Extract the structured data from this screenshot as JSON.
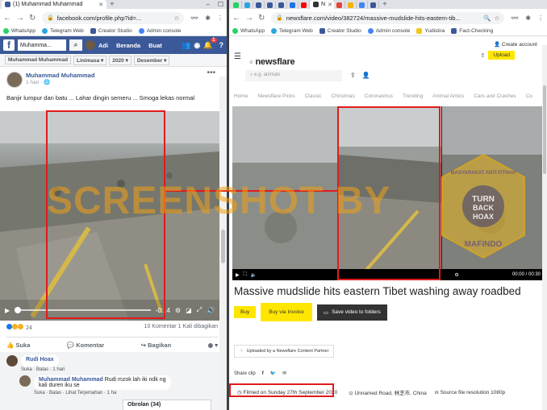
{
  "left_browser": {
    "tab_title": "(1) Muhammad Muhammad",
    "url": "facebook.com/profile.php?id=...",
    "bookmarks": [
      "WhatsApp",
      "Telegram Web",
      "Creator Studio",
      "Admin console"
    ]
  },
  "facebook": {
    "search_value": "Muhamma...",
    "nav": [
      "Adi",
      "Beranda",
      "Buat"
    ],
    "notif_count": "1",
    "subbar": [
      "Muhammad Muhammad",
      "Linimasa ▾",
      "2020 ▾",
      "Desember ▾"
    ],
    "post": {
      "author": "Muhammad Muhammad",
      "time": "1 hari · 🌐",
      "text": "Banjir lumpur dan batu ... Lahar dingin semeru ... Smoga lekas normal"
    },
    "video": {
      "time": "-0:14"
    },
    "reactions_count": "24",
    "stats": "10 Komentar  1 Kali dibagikan",
    "actions": [
      "Suka",
      "Komentar",
      "Bagikan"
    ],
    "comments": [
      {
        "author": "Rudi Hoax",
        "text": "",
        "meta": "Suka · Balas · 1 hari"
      },
      {
        "author": "Muhammad Muhammad",
        "text": "Rudi mzok lah iki ndk ng kali duren iku se",
        "meta": "Suka · Balas · Lihat Terjemahan · 1 ha"
      }
    ],
    "chat": "Obrolan (34)"
  },
  "right_browser": {
    "tab_title": "N",
    "url": "newsflare.com/video/382724/massive-mudslide-hits-eastern-tib...",
    "bookmarks": [
      "WhatsApp",
      "Telegram Web",
      "Creator Studio",
      "Admin console",
      "Yudistira",
      "Fact-Checking"
    ]
  },
  "newsflare": {
    "create_account": "Create account",
    "upload": "Upload",
    "logo": "newsflare",
    "search_placeholder": "e.g. animals",
    "nav": [
      "Home",
      "Newsflare Picks",
      "Classic",
      "Christmas",
      "Coronavirus",
      "Trending",
      "Animal Antics",
      "Cars and Crashes",
      "Co"
    ],
    "player_time": "00:00  /  00:30",
    "title": "Massive mudslide hits eastern Tibet washing away roadbed",
    "buy": "Buy",
    "buy_invoice": "Buy via Invoice",
    "save": "Save video to folders",
    "partner": "Uploaded by a Newsflare Content Partner",
    "share": "Share clip",
    "filmed": "Filmed on Sunday 27th September 2020",
    "location": "Unnamed Road, 林芝市, China",
    "resolution": "Source file resolution 1080p"
  },
  "overlay": {
    "watermark": "SCREENSHOT BY",
    "stamp_top": "MASYARAKAT ANTI FITNAH INDONESIA",
    "stamp_center": "TURN BACK HOAX",
    "stamp_bottom": "MAFINDO"
  },
  "colors": {
    "facebook_blue": "#3b5998",
    "newsflare_yellow": "#ffe600",
    "highlight_red": "#e01b1b"
  }
}
